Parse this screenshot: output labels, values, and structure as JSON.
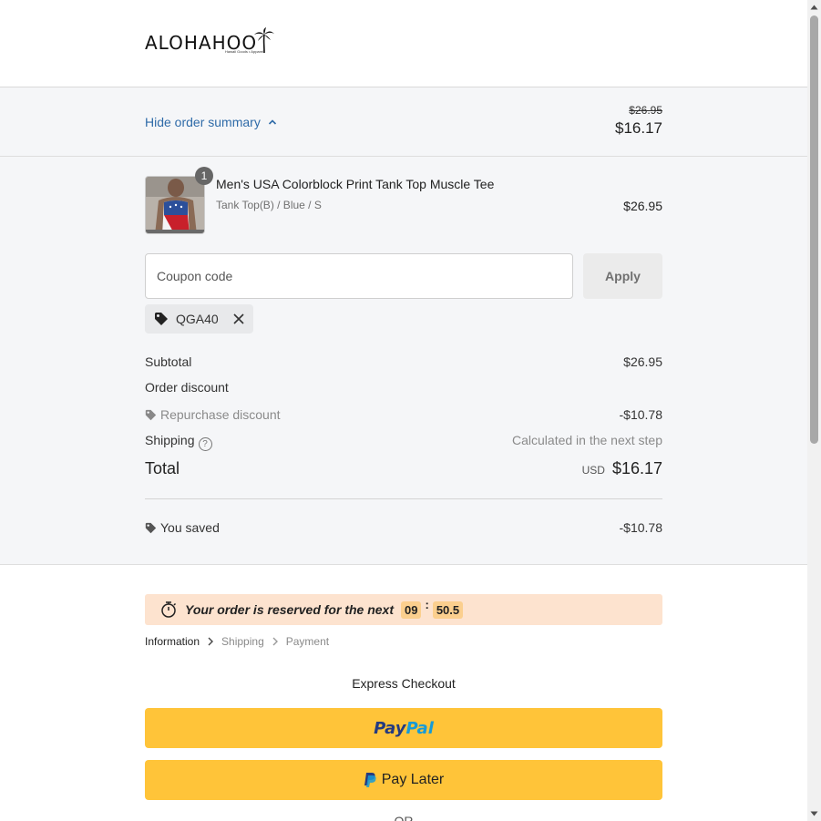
{
  "header": {
    "logo_text": "ALOHAHOO",
    "logo_tagline": "Hawaii Goods • Apparel"
  },
  "summary_bar": {
    "toggle_label": "Hide order summary",
    "old_price": "$26.95",
    "current_price": "$16.17"
  },
  "product": {
    "name": "Men's USA Colorblock Print Tank Top Muscle Tee",
    "variant": "Tank Top(B) / Blue / S",
    "price": "$26.95",
    "quantity": "1"
  },
  "coupon": {
    "placeholder": "Coupon code",
    "value": "",
    "apply_label": "Apply",
    "applied_code": "QGA40"
  },
  "lines": {
    "subtotal_label": "Subtotal",
    "subtotal_value": "$26.95",
    "order_discount_label": "Order discount",
    "repurchase_label": "Repurchase discount",
    "repurchase_value": "-$10.78",
    "shipping_label": "Shipping",
    "shipping_help": "?",
    "shipping_value": "Calculated in the next step",
    "total_label": "Total",
    "currency": "USD",
    "total_value": "$16.17",
    "saved_label": "You saved",
    "saved_value": "-$10.78"
  },
  "timer": {
    "text": "Your order is reserved for the next",
    "minutes": "09",
    "separator": ":",
    "seconds": "50.5"
  },
  "breadcrumbs": {
    "information": "Information",
    "shipping": "Shipping",
    "payment": "Payment"
  },
  "express": {
    "title": "Express Checkout",
    "paypal_part1": "Pay",
    "paypal_part2": "Pal",
    "paylater_label": "Pay Later",
    "or_label": "OR"
  },
  "colors": {
    "link": "#2f6ba8",
    "paypal_yellow": "#ffc439",
    "timer_bg": "#fde3cf",
    "timer_box": "#fbcf8e"
  }
}
